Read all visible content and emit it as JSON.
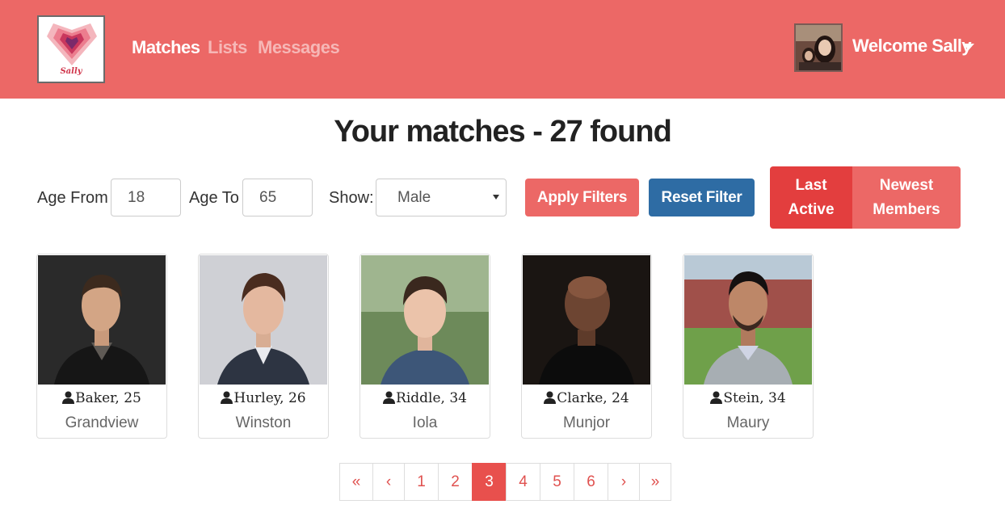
{
  "brand": {
    "logo_text": "Sally"
  },
  "nav": {
    "links": [
      "Matches",
      "Lists",
      "Messages"
    ],
    "welcome": "Welcome Sally"
  },
  "page": {
    "title": "Your matches - 27 found"
  },
  "filters": {
    "age_from_label": "Age From",
    "age_from_value": "18",
    "age_to_label": "Age To",
    "age_to_value": "65",
    "show_label": "Show:",
    "show_value": "Male",
    "apply_label": "Apply Filters",
    "reset_label": "Reset Filter",
    "sort": {
      "last_active": [
        "Last",
        "Active"
      ],
      "newest_members": [
        "Newest",
        "Members"
      ]
    }
  },
  "matches": [
    {
      "name": "Baker, 25",
      "city": "Grandview"
    },
    {
      "name": "Hurley, 26",
      "city": "Winston"
    },
    {
      "name": "Riddle, 34",
      "city": "Iola"
    },
    {
      "name": "Clarke, 24",
      "city": "Munjor"
    },
    {
      "name": "Stein, 34",
      "city": "Maury"
    }
  ],
  "pagination": {
    "items": [
      "«",
      "‹",
      "1",
      "2",
      "3",
      "4",
      "5",
      "6",
      "›",
      "»"
    ],
    "current": "3"
  },
  "colors": {
    "navbar": "#ec6866",
    "accent": "#e8504d",
    "reset_button": "#2e6ca4"
  }
}
